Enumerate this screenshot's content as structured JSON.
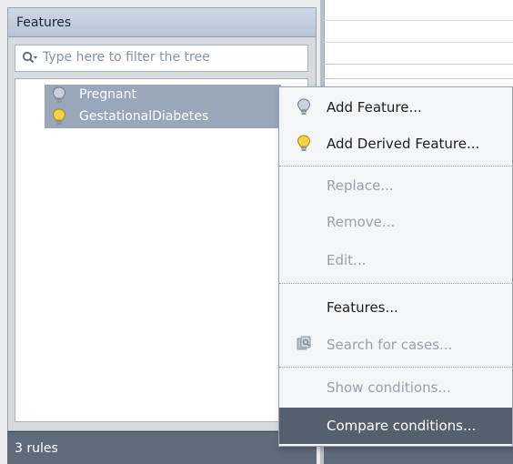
{
  "panel": {
    "title": "Features",
    "filter_placeholder": "Type here to filter the tree",
    "tree_items": [
      {
        "label": "Pregnant",
        "icon": "bulb-gray-icon"
      },
      {
        "label": "GestationalDiabetes",
        "icon": "bulb-yellow-icon"
      }
    ]
  },
  "status": {
    "rules": "3 rules"
  },
  "menu": {
    "items": [
      {
        "label": "Add Feature...",
        "enabled": true,
        "icon": "bulb-gray-icon"
      },
      {
        "label": "Add Derived Feature...",
        "enabled": true,
        "icon": "bulb-yellow-icon"
      },
      {
        "label": "Replace...",
        "enabled": false
      },
      {
        "label": "Remove...",
        "enabled": false
      },
      {
        "label": "Edit...",
        "enabled": false
      },
      {
        "label": "Features...",
        "enabled": true
      },
      {
        "label": "Search for cases...",
        "enabled": false,
        "icon": "search-cases-icon"
      },
      {
        "label": "Show conditions...",
        "enabled": false
      },
      {
        "label": "Compare conditions...",
        "enabled": true,
        "highlighted": true
      }
    ]
  },
  "colors": {
    "accent": "#55606e",
    "selection": "#9aa7ba",
    "status_bar": "#5f6b7a"
  }
}
